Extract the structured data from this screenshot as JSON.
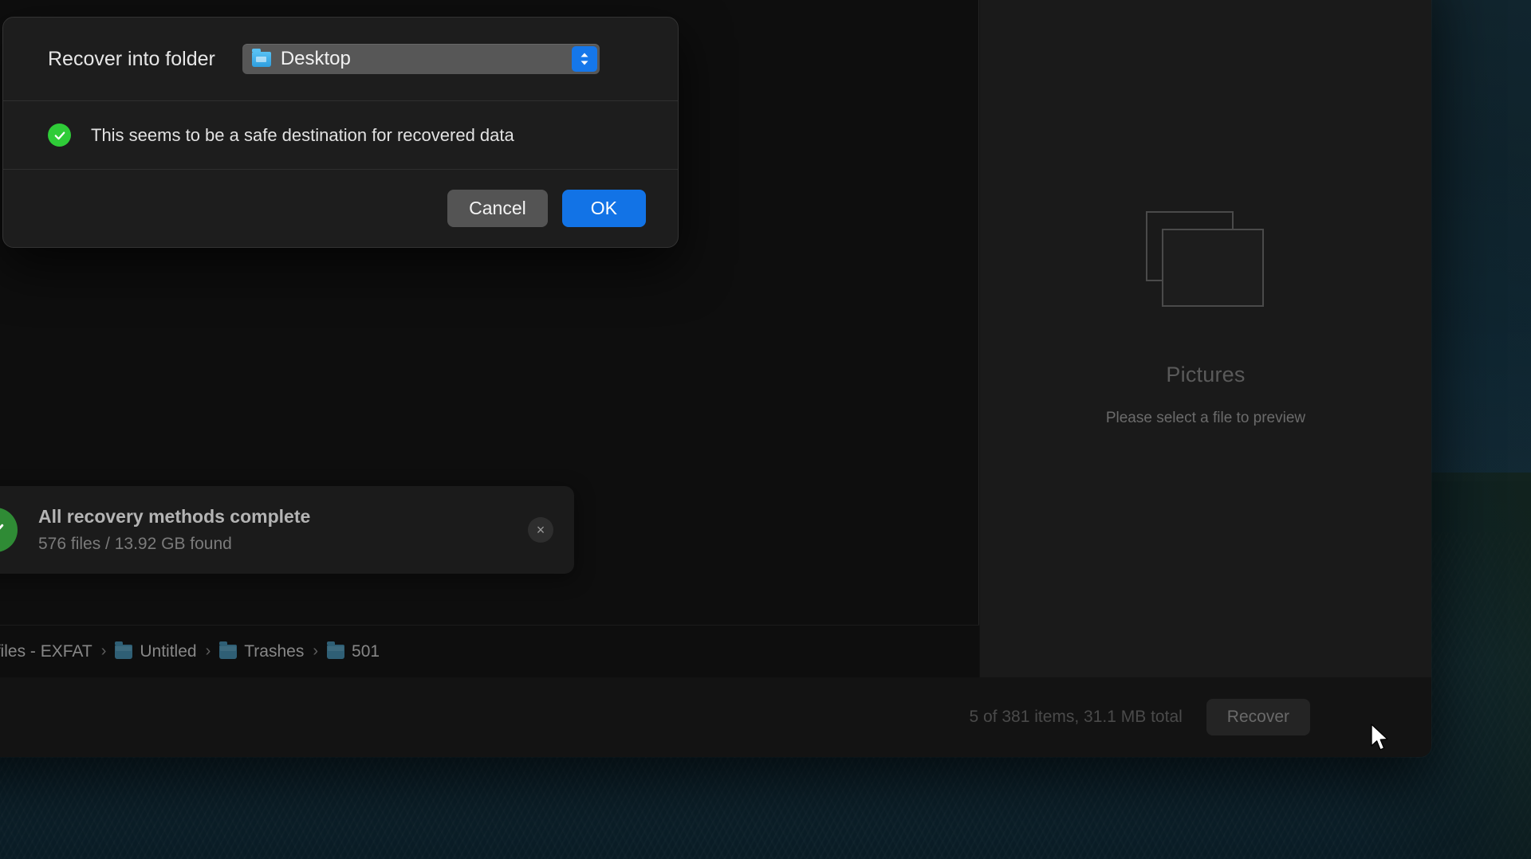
{
  "app": {
    "preview_panel": {
      "icon_name": "stacked-images-icon",
      "title": "Pictures",
      "subtitle": "Please select a file to preview"
    },
    "breadcrumb": {
      "items": [
        {
          "label": "",
          "icon": "folder-icon"
        },
        {
          "label": "Existing files - EXFAT",
          "icon": "folder-icon"
        },
        {
          "label": "Untitled",
          "icon": "folder-icon"
        },
        {
          "label": "Trashes",
          "icon": "folder-icon"
        },
        {
          "label": "501",
          "icon": "folder-icon"
        }
      ],
      "separator": "›"
    },
    "status_bar": {
      "status_text": "5 of 381 items, 31.1 MB total",
      "recover_label": "Recover"
    }
  },
  "toast": {
    "icon": "check-circle-icon",
    "title": "All recovery methods complete",
    "subtitle": "576 files / 13.92 GB found",
    "close_label": "×",
    "accent_color": "#2f8b35"
  },
  "dialog": {
    "folder_row": {
      "label": "Recover into folder",
      "select_value": "Desktop",
      "select_icon": "blue-folder-icon",
      "stepper_icon": "up-down-chevrons-icon",
      "stepper_color": "#1577ea"
    },
    "status_row": {
      "icon": "green-check-circle-icon",
      "text": "This seems to be a safe destination for recovered data",
      "accent_color": "#2fcc38"
    },
    "actions": {
      "cancel_label": "Cancel",
      "ok_label": "OK",
      "ok_color": "#1273e6"
    }
  },
  "cursor": {
    "icon": "arrow-pointer-icon"
  }
}
